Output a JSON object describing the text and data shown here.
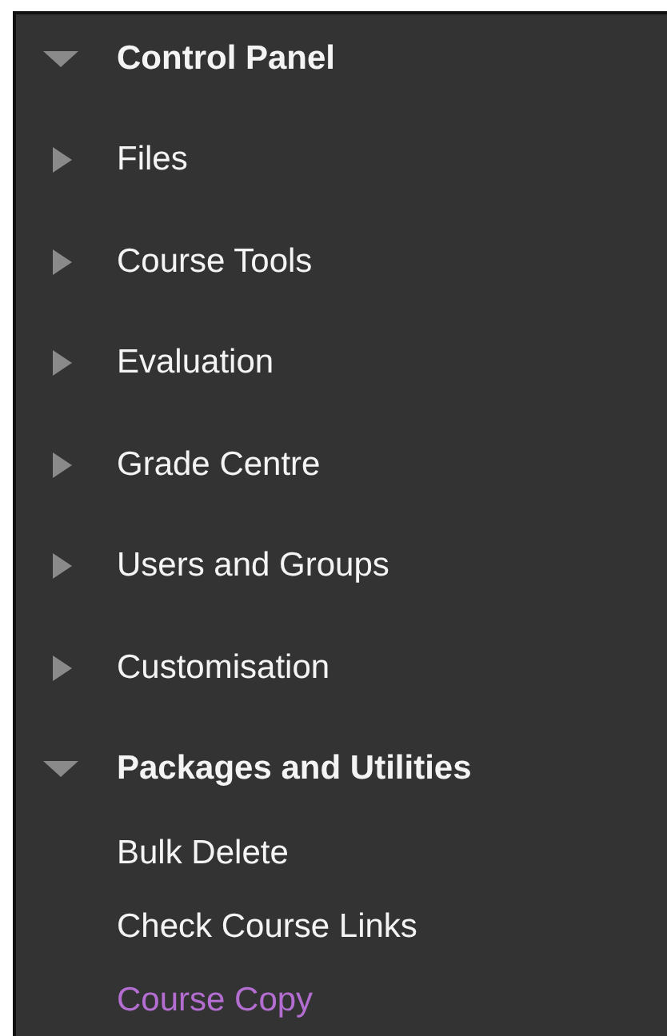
{
  "sections": [
    {
      "label": "Control Panel",
      "expanded": true
    },
    {
      "label": "Files",
      "expanded": false
    },
    {
      "label": "Course Tools",
      "expanded": false
    },
    {
      "label": "Evaluation",
      "expanded": false
    },
    {
      "label": "Grade Centre",
      "expanded": false
    },
    {
      "label": "Users and Groups",
      "expanded": false
    },
    {
      "label": "Customisation",
      "expanded": false
    },
    {
      "label": "Packages and Utilities",
      "expanded": true,
      "children": [
        {
          "label": "Bulk Delete",
          "visited": false
        },
        {
          "label": "Check Course Links",
          "visited": false
        },
        {
          "label": "Course Copy",
          "visited": true
        }
      ]
    }
  ]
}
